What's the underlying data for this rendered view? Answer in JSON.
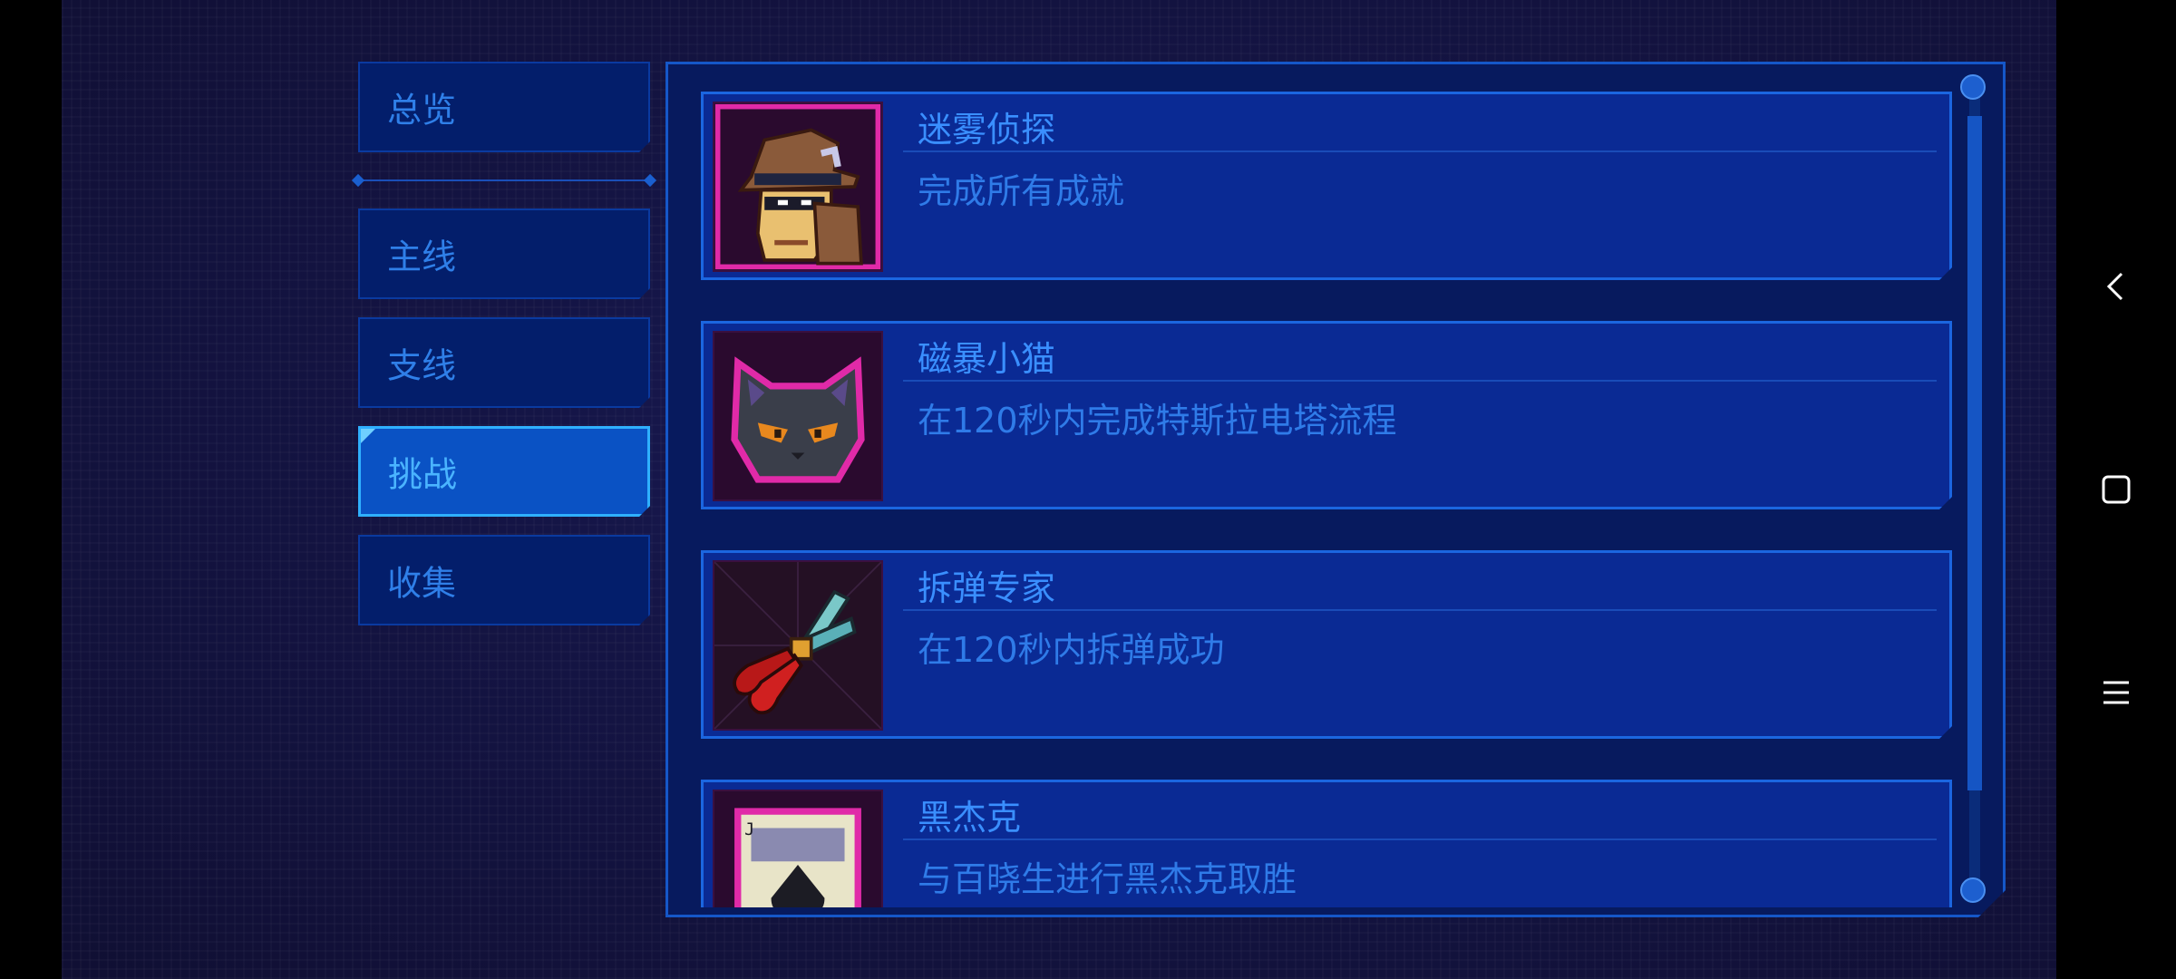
{
  "tabs": [
    {
      "label": "总览",
      "active": false
    },
    {
      "label": "主线",
      "active": false
    },
    {
      "label": "支线",
      "active": false
    },
    {
      "label": "挑战",
      "active": true
    },
    {
      "label": "收集",
      "active": false
    }
  ],
  "achievements": [
    {
      "title": "迷雾侦探",
      "description": "完成所有成就",
      "icon": "detective-icon"
    },
    {
      "title": "磁暴小猫",
      "description": "在120秒内完成特斯拉电塔流程",
      "icon": "cat-icon"
    },
    {
      "title": "拆弹专家",
      "description": "在120秒内拆弹成功",
      "icon": "pliers-icon"
    },
    {
      "title": "黑杰克",
      "description": "与百晓生进行黑杰克取胜",
      "icon": "playing-card-icon"
    }
  ],
  "colors": {
    "panel_bg": "#071a5e",
    "card_bg": "#0a2a94",
    "accent": "#2fb0ff",
    "text": "#2f7be8",
    "close_border": "#d43ab8"
  },
  "navbar": {
    "buttons": [
      "back-icon",
      "home-icon",
      "menu-icon"
    ]
  }
}
